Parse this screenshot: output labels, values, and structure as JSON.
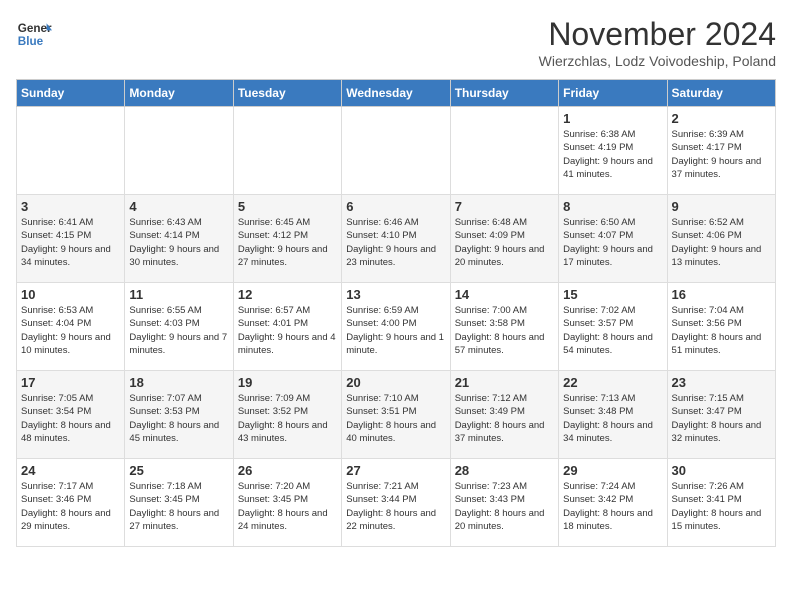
{
  "logo": {
    "general": "General",
    "blue": "Blue"
  },
  "title": "November 2024",
  "location": "Wierzchlas, Lodz Voivodeship, Poland",
  "headers": [
    "Sunday",
    "Monday",
    "Tuesday",
    "Wednesday",
    "Thursday",
    "Friday",
    "Saturday"
  ],
  "weeks": [
    [
      {
        "day": "",
        "sunrise": "",
        "sunset": "",
        "daylight": ""
      },
      {
        "day": "",
        "sunrise": "",
        "sunset": "",
        "daylight": ""
      },
      {
        "day": "",
        "sunrise": "",
        "sunset": "",
        "daylight": ""
      },
      {
        "day": "",
        "sunrise": "",
        "sunset": "",
        "daylight": ""
      },
      {
        "day": "",
        "sunrise": "",
        "sunset": "",
        "daylight": ""
      },
      {
        "day": "1",
        "sunrise": "Sunrise: 6:38 AM",
        "sunset": "Sunset: 4:19 PM",
        "daylight": "Daylight: 9 hours and 41 minutes."
      },
      {
        "day": "2",
        "sunrise": "Sunrise: 6:39 AM",
        "sunset": "Sunset: 4:17 PM",
        "daylight": "Daylight: 9 hours and 37 minutes."
      }
    ],
    [
      {
        "day": "3",
        "sunrise": "Sunrise: 6:41 AM",
        "sunset": "Sunset: 4:15 PM",
        "daylight": "Daylight: 9 hours and 34 minutes."
      },
      {
        "day": "4",
        "sunrise": "Sunrise: 6:43 AM",
        "sunset": "Sunset: 4:14 PM",
        "daylight": "Daylight: 9 hours and 30 minutes."
      },
      {
        "day": "5",
        "sunrise": "Sunrise: 6:45 AM",
        "sunset": "Sunset: 4:12 PM",
        "daylight": "Daylight: 9 hours and 27 minutes."
      },
      {
        "day": "6",
        "sunrise": "Sunrise: 6:46 AM",
        "sunset": "Sunset: 4:10 PM",
        "daylight": "Daylight: 9 hours and 23 minutes."
      },
      {
        "day": "7",
        "sunrise": "Sunrise: 6:48 AM",
        "sunset": "Sunset: 4:09 PM",
        "daylight": "Daylight: 9 hours and 20 minutes."
      },
      {
        "day": "8",
        "sunrise": "Sunrise: 6:50 AM",
        "sunset": "Sunset: 4:07 PM",
        "daylight": "Daylight: 9 hours and 17 minutes."
      },
      {
        "day": "9",
        "sunrise": "Sunrise: 6:52 AM",
        "sunset": "Sunset: 4:06 PM",
        "daylight": "Daylight: 9 hours and 13 minutes."
      }
    ],
    [
      {
        "day": "10",
        "sunrise": "Sunrise: 6:53 AM",
        "sunset": "Sunset: 4:04 PM",
        "daylight": "Daylight: 9 hours and 10 minutes."
      },
      {
        "day": "11",
        "sunrise": "Sunrise: 6:55 AM",
        "sunset": "Sunset: 4:03 PM",
        "daylight": "Daylight: 9 hours and 7 minutes."
      },
      {
        "day": "12",
        "sunrise": "Sunrise: 6:57 AM",
        "sunset": "Sunset: 4:01 PM",
        "daylight": "Daylight: 9 hours and 4 minutes."
      },
      {
        "day": "13",
        "sunrise": "Sunrise: 6:59 AM",
        "sunset": "Sunset: 4:00 PM",
        "daylight": "Daylight: 9 hours and 1 minute."
      },
      {
        "day": "14",
        "sunrise": "Sunrise: 7:00 AM",
        "sunset": "Sunset: 3:58 PM",
        "daylight": "Daylight: 8 hours and 57 minutes."
      },
      {
        "day": "15",
        "sunrise": "Sunrise: 7:02 AM",
        "sunset": "Sunset: 3:57 PM",
        "daylight": "Daylight: 8 hours and 54 minutes."
      },
      {
        "day": "16",
        "sunrise": "Sunrise: 7:04 AM",
        "sunset": "Sunset: 3:56 PM",
        "daylight": "Daylight: 8 hours and 51 minutes."
      }
    ],
    [
      {
        "day": "17",
        "sunrise": "Sunrise: 7:05 AM",
        "sunset": "Sunset: 3:54 PM",
        "daylight": "Daylight: 8 hours and 48 minutes."
      },
      {
        "day": "18",
        "sunrise": "Sunrise: 7:07 AM",
        "sunset": "Sunset: 3:53 PM",
        "daylight": "Daylight: 8 hours and 45 minutes."
      },
      {
        "day": "19",
        "sunrise": "Sunrise: 7:09 AM",
        "sunset": "Sunset: 3:52 PM",
        "daylight": "Daylight: 8 hours and 43 minutes."
      },
      {
        "day": "20",
        "sunrise": "Sunrise: 7:10 AM",
        "sunset": "Sunset: 3:51 PM",
        "daylight": "Daylight: 8 hours and 40 minutes."
      },
      {
        "day": "21",
        "sunrise": "Sunrise: 7:12 AM",
        "sunset": "Sunset: 3:49 PM",
        "daylight": "Daylight: 8 hours and 37 minutes."
      },
      {
        "day": "22",
        "sunrise": "Sunrise: 7:13 AM",
        "sunset": "Sunset: 3:48 PM",
        "daylight": "Daylight: 8 hours and 34 minutes."
      },
      {
        "day": "23",
        "sunrise": "Sunrise: 7:15 AM",
        "sunset": "Sunset: 3:47 PM",
        "daylight": "Daylight: 8 hours and 32 minutes."
      }
    ],
    [
      {
        "day": "24",
        "sunrise": "Sunrise: 7:17 AM",
        "sunset": "Sunset: 3:46 PM",
        "daylight": "Daylight: 8 hours and 29 minutes."
      },
      {
        "day": "25",
        "sunrise": "Sunrise: 7:18 AM",
        "sunset": "Sunset: 3:45 PM",
        "daylight": "Daylight: 8 hours and 27 minutes."
      },
      {
        "day": "26",
        "sunrise": "Sunrise: 7:20 AM",
        "sunset": "Sunset: 3:45 PM",
        "daylight": "Daylight: 8 hours and 24 minutes."
      },
      {
        "day": "27",
        "sunrise": "Sunrise: 7:21 AM",
        "sunset": "Sunset: 3:44 PM",
        "daylight": "Daylight: 8 hours and 22 minutes."
      },
      {
        "day": "28",
        "sunrise": "Sunrise: 7:23 AM",
        "sunset": "Sunset: 3:43 PM",
        "daylight": "Daylight: 8 hours and 20 minutes."
      },
      {
        "day": "29",
        "sunrise": "Sunrise: 7:24 AM",
        "sunset": "Sunset: 3:42 PM",
        "daylight": "Daylight: 8 hours and 18 minutes."
      },
      {
        "day": "30",
        "sunrise": "Sunrise: 7:26 AM",
        "sunset": "Sunset: 3:41 PM",
        "daylight": "Daylight: 8 hours and 15 minutes."
      }
    ]
  ]
}
